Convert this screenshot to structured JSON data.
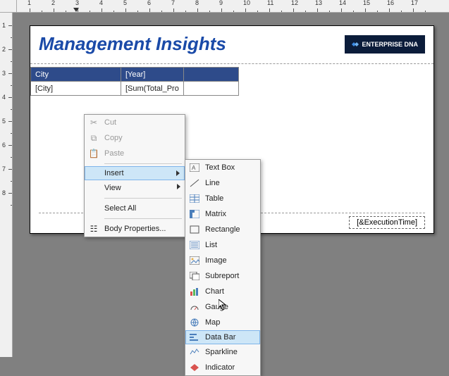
{
  "ruler_h": [
    1,
    2,
    3,
    4,
    5,
    6,
    7,
    8,
    9,
    10,
    11,
    12,
    13,
    14,
    15,
    16,
    17
  ],
  "ruler_v": [
    1,
    2,
    3,
    4,
    5,
    6,
    7,
    8
  ],
  "report": {
    "title": "Management Insights",
    "brand": "ENTERPRISE DNA",
    "table": {
      "headers": [
        "City",
        "[Year]",
        ""
      ],
      "row": [
        "[City]",
        "[Sum(Total_Pro",
        ""
      ]
    },
    "footer": "[&ExecutionTime]"
  },
  "context_menu": {
    "cut": "Cut",
    "copy": "Copy",
    "paste": "Paste",
    "insert": "Insert",
    "view": "View",
    "select_all": "Select All",
    "body_props": "Body Properties..."
  },
  "insert_submenu": {
    "text_box": "Text Box",
    "line": "Line",
    "table": "Table",
    "matrix": "Matrix",
    "rectangle": "Rectangle",
    "list": "List",
    "image": "Image",
    "subreport": "Subreport",
    "chart": "Chart",
    "gauge": "Gauge",
    "map": "Map",
    "data_bar": "Data Bar",
    "sparkline": "Sparkline",
    "indicator": "Indicator"
  }
}
